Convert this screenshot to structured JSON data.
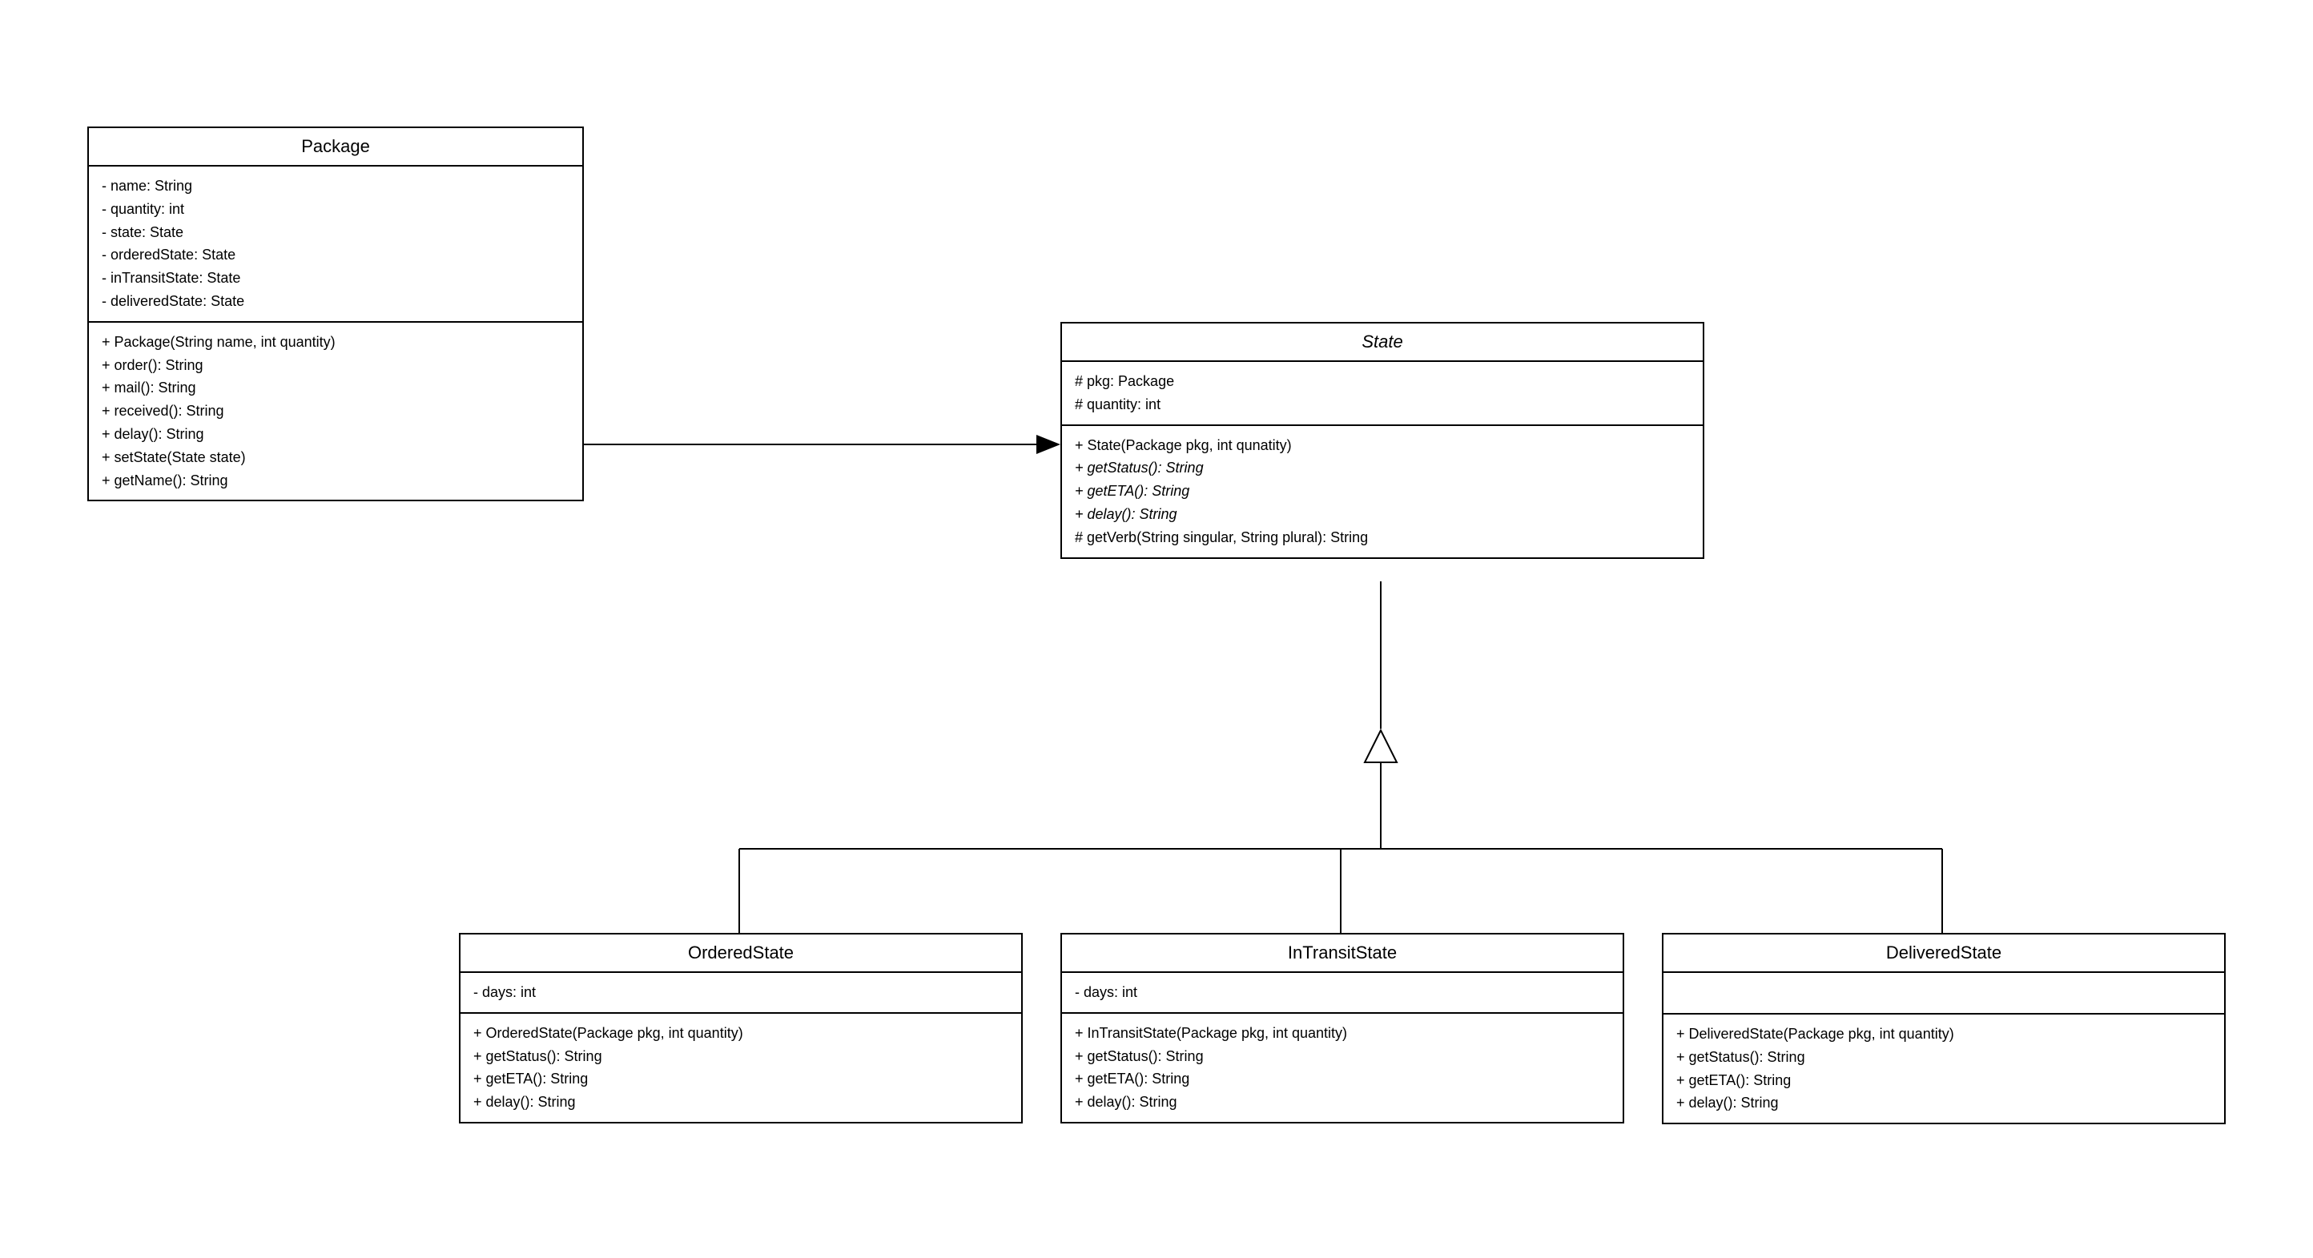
{
  "classes": {
    "package": {
      "name": "Package",
      "nameStyle": "normal",
      "attributes": [
        "- name: String",
        "- quantity: int",
        "- state: State",
        "- orderedState: State",
        "- inTransitState: State",
        "- deliveredState: State"
      ],
      "methods": [
        "+ Package(String name, int quantity)",
        "+ order(): String",
        "+ mail(): String",
        "+ received(): String",
        "+ delay(): String",
        "+ setState(State state)",
        "+ getName(): String"
      ]
    },
    "state": {
      "name": "State",
      "nameStyle": "italic",
      "attributes": [
        "# pkg: Package",
        "# quantity: int"
      ],
      "methods": [
        {
          "text": "+ State(Package pkg, int qunatity)",
          "style": "normal"
        },
        {
          "text": "+ getStatus(): String",
          "style": "italic"
        },
        {
          "text": "+ getETA(): String",
          "style": "italic"
        },
        {
          "text": "+ delay(): String",
          "style": "italic"
        },
        {
          "text": "# getVerb(String singular, String plural): String",
          "style": "normal"
        }
      ]
    },
    "orderedState": {
      "name": "OrderedState",
      "attributes": [
        "- days: int"
      ],
      "methods": [
        "+ OrderedState(Package pkg, int quantity)",
        "+ getStatus(): String",
        "+ getETA(): String",
        "+ delay(): String"
      ]
    },
    "inTransitState": {
      "name": "InTransitState",
      "attributes": [
        "- days: int"
      ],
      "methods": [
        "+ InTransitState(Package pkg, int quantity)",
        "+ getStatus(): String",
        "+ getETA(): String",
        "+ delay(): String"
      ]
    },
    "deliveredState": {
      "name": "DeliveredState",
      "attributes": [],
      "methods": [
        "+ DeliveredState(Package pkg, int quantity)",
        "+ getStatus(): String",
        "+ getETA(): String",
        "+ delay(): String"
      ]
    }
  },
  "relationships": [
    {
      "from": "package",
      "to": "state",
      "type": "association-arrow"
    },
    {
      "from": "orderedState",
      "to": "state",
      "type": "generalization"
    },
    {
      "from": "inTransitState",
      "to": "state",
      "type": "generalization"
    },
    {
      "from": "deliveredState",
      "to": "state",
      "type": "generalization"
    }
  ]
}
